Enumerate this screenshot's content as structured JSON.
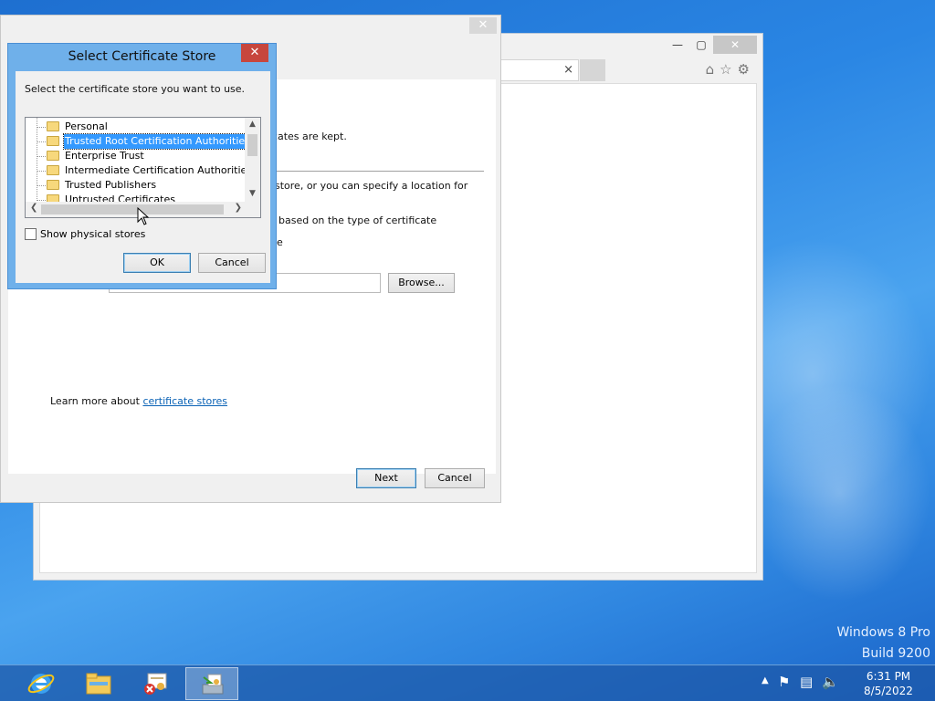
{
  "desktop": {
    "watermark_line1": "Windows 8 Pro",
    "watermark_line2": "Build 9200"
  },
  "browser": {
    "tab_close": "×",
    "tools": [
      "home-icon",
      "star-icon",
      "gear-icon"
    ]
  },
  "wizard": {
    "text_where_kept": "ficates are kept.",
    "text_specify_line1": "store, or you can specify a location for",
    "text_based_on": "based on the type of certificate",
    "text_partial_e": "e",
    "browse_label": "Browse...",
    "learn_more_prefix": "Learn more about ",
    "learn_more_link": "certificate stores",
    "next_label": "Next",
    "cancel_label": "Cancel"
  },
  "dialog": {
    "title": "Select Certificate Store",
    "prompt": "Select the certificate store you want to use.",
    "tree_items": [
      {
        "label": "Personal",
        "selected": false
      },
      {
        "label": "Trusted Root Certification Authorities",
        "selected": true
      },
      {
        "label": "Enterprise Trust",
        "selected": false
      },
      {
        "label": "Intermediate Certification Authorities",
        "selected": false
      },
      {
        "label": "Trusted Publishers",
        "selected": false
      },
      {
        "label": "Untrusted Certificates",
        "selected": false
      }
    ],
    "show_physical_label": "Show physical stores",
    "show_physical_checked": false,
    "ok_label": "OK",
    "cancel_label": "Cancel"
  },
  "taskbar": {
    "items": [
      "internet-explorer-icon",
      "file-explorer-icon",
      "certificate-error-icon",
      "certificate-import-icon"
    ],
    "active_index": 3,
    "clock_time": "6:31 PM",
    "clock_date": "8/5/2022"
  }
}
